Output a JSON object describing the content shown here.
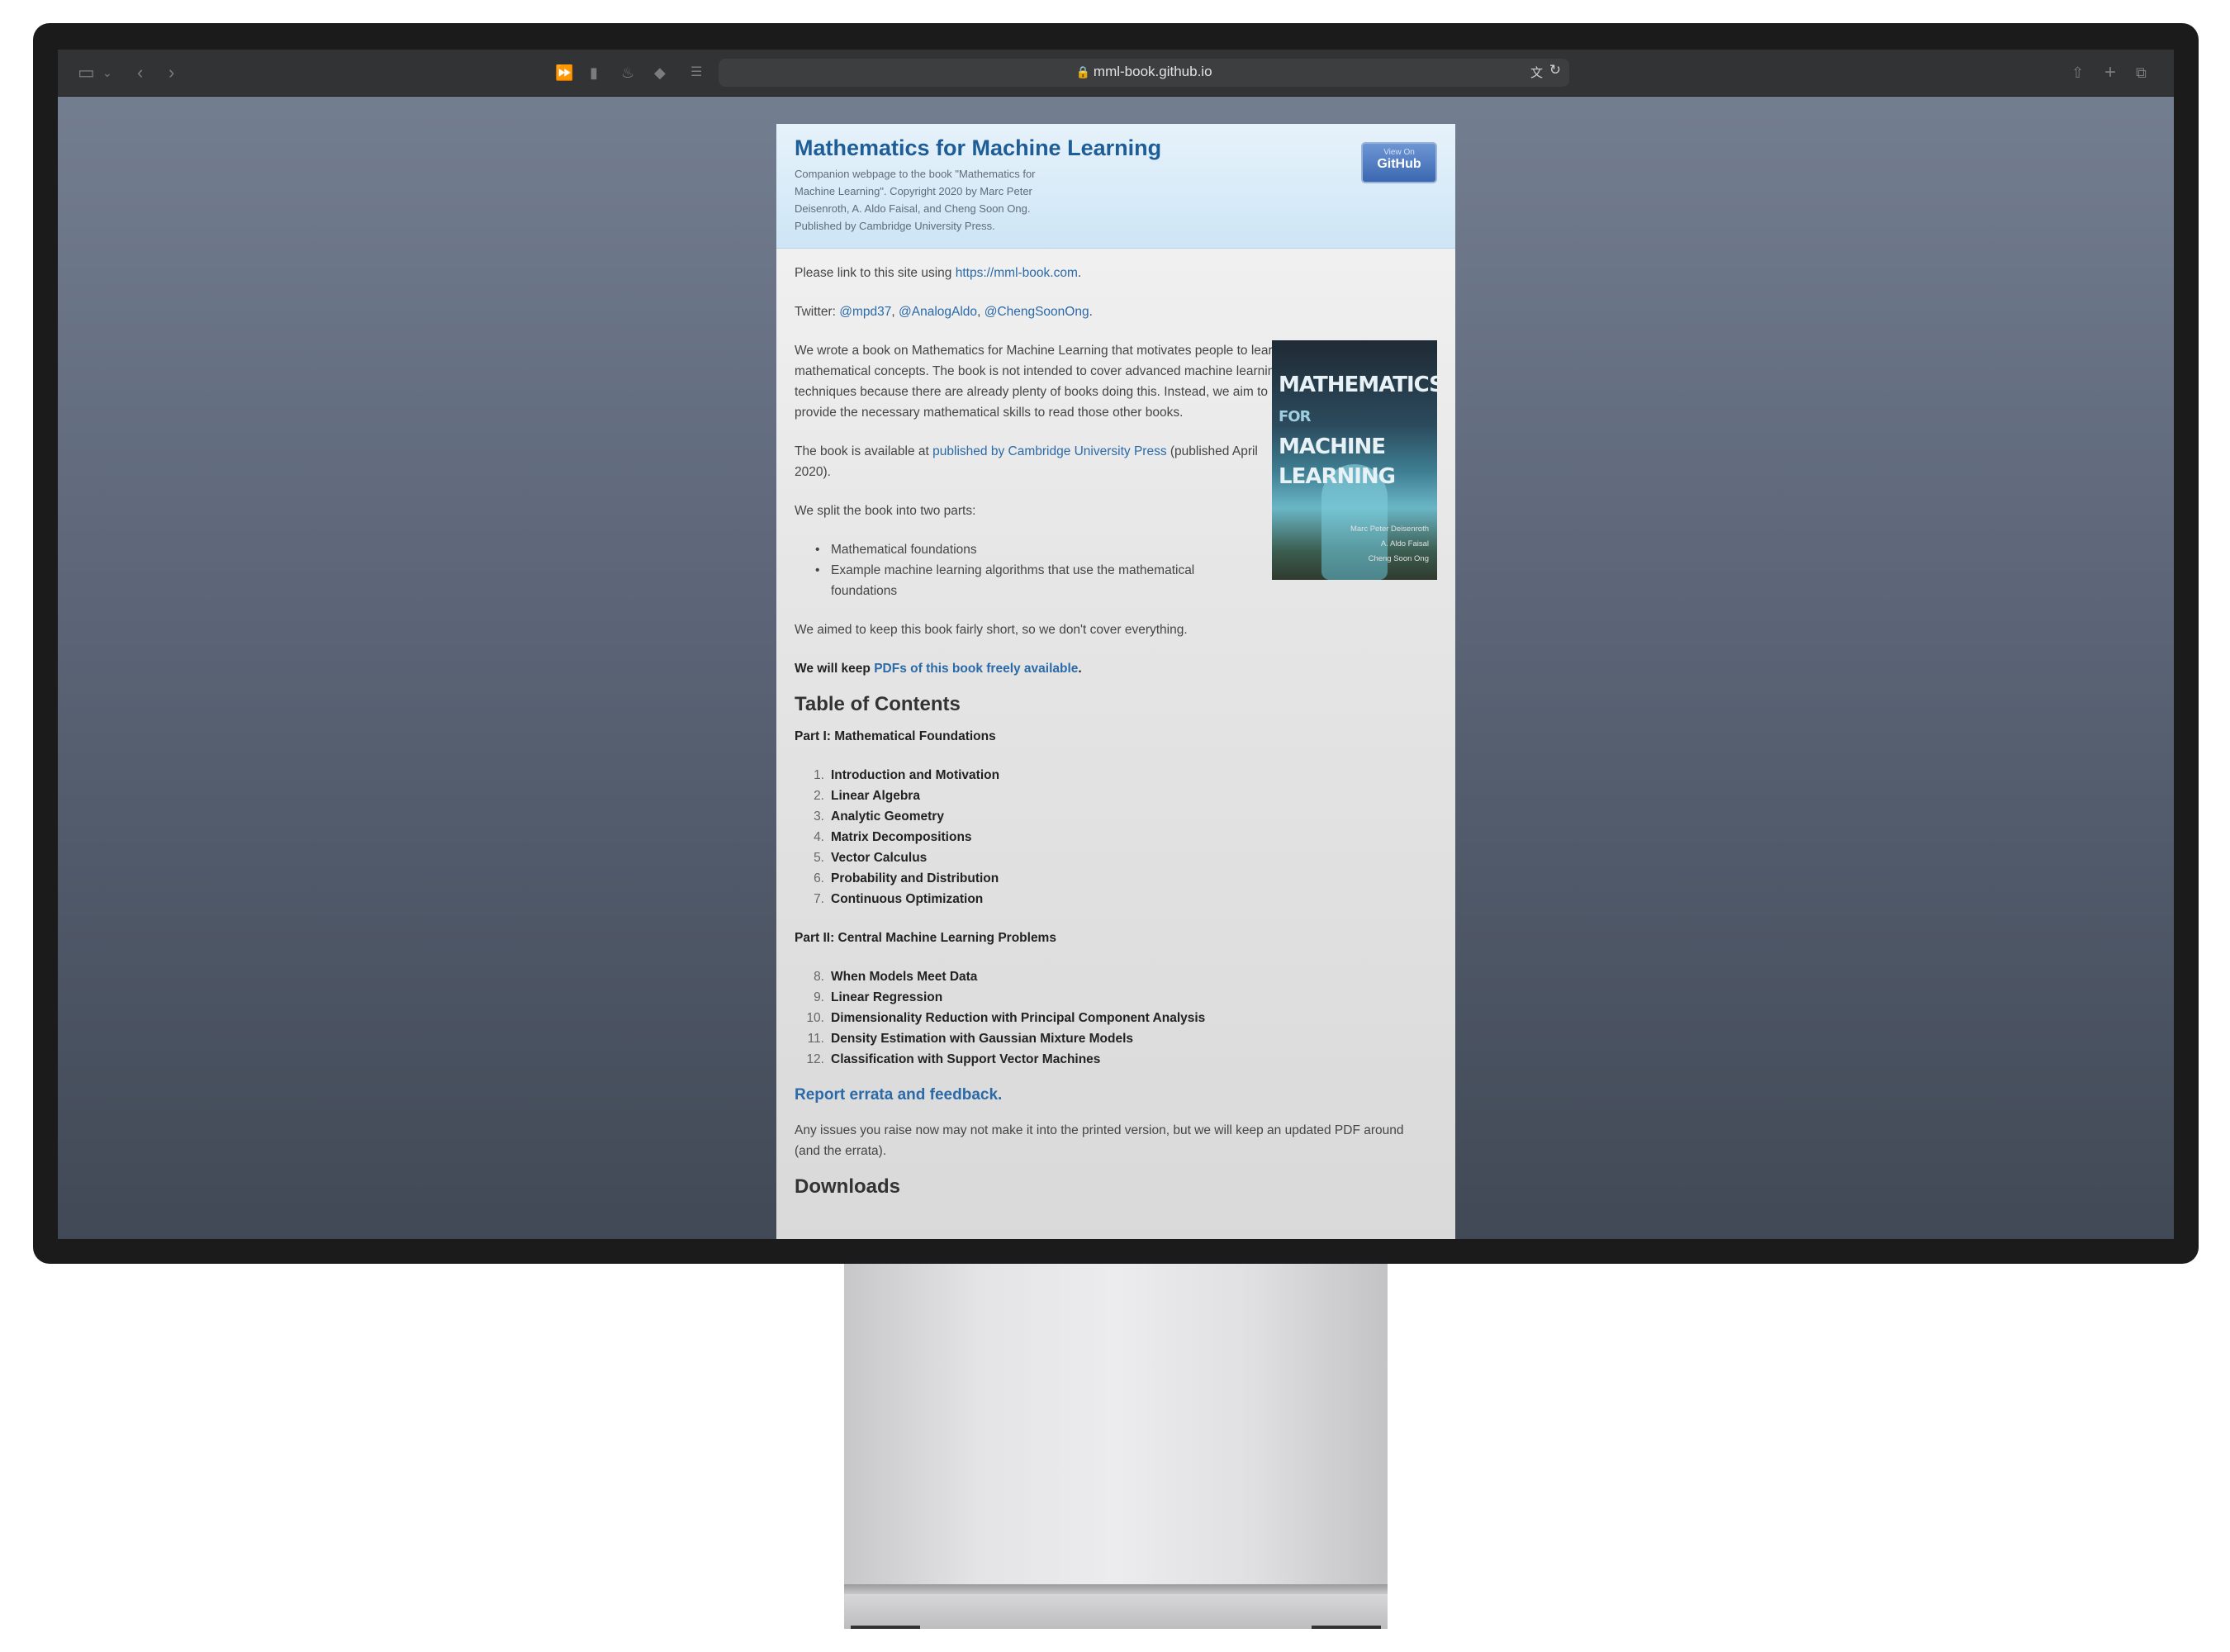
{
  "browser": {
    "url": "mml-book.github.io"
  },
  "site": {
    "title": "Mathematics for Machine Learning",
    "tagline": "Companion webpage to the book \"Mathematics for Machine Learning\". Copyright 2020 by Marc Peter Deisenroth, A. Aldo Faisal, and Cheng Soon Ong. Published by Cambridge University Press.",
    "github_small": "View On",
    "github_big": "GitHub"
  },
  "intro": {
    "link_prefix": "Please link to this site using ",
    "link": "https://mml-book.com",
    "link_suffix": ".",
    "twitter_prefix": "Twitter: ",
    "twitter_1": "@mpd37",
    "twitter_sep1": ", ",
    "twitter_2": "@AnalogAldo",
    "twitter_sep2": ", ",
    "twitter_3": "@ChengSoonOng",
    "twitter_suffix": ".",
    "para1": "We wrote a book on Mathematics for Machine Learning that motivates people to learn mathematical concepts. The book is not intended to cover advanced machine learning techniques because there are already plenty of books doing this. Instead, we aim to provide the necessary mathematical skills to read those other books.",
    "avail_prefix": "The book is available at ",
    "avail_link": "published by Cambridge University Press",
    "avail_suffix": " (published April 2020).",
    "split": "We split the book into two parts:",
    "parts": [
      "Mathematical foundations",
      "Example machine learning algorithms that use the mathematical foundations"
    ],
    "short": "We aimed to keep this book fairly short, so we don't cover everything.",
    "keep_prefix": "We will keep ",
    "keep_link": "PDFs of this book freely available",
    "keep_suffix": "."
  },
  "cover": {
    "title_1": "MATHEMATICS",
    "title_for": "FOR",
    "title_2": "MACHINE LEARNING",
    "author_1": "Marc Peter Deisenroth",
    "author_2": "A. Aldo Faisal",
    "author_3": "Cheng Soon Ong"
  },
  "toc": {
    "heading": "Table of Contents",
    "part1": "Part I: Mathematical Foundations",
    "part1_items": [
      {
        "num": "1.",
        "label": "Introduction and Motivation"
      },
      {
        "num": "2.",
        "label": "Linear Algebra"
      },
      {
        "num": "3.",
        "label": "Analytic Geometry"
      },
      {
        "num": "4.",
        "label": "Matrix Decompositions"
      },
      {
        "num": "5.",
        "label": "Vector Calculus"
      },
      {
        "num": "6.",
        "label": "Probability and Distribution"
      },
      {
        "num": "7.",
        "label": "Continuous Optimization"
      }
    ],
    "part2": "Part II: Central Machine Learning Problems",
    "part2_items": [
      {
        "num": "8.",
        "label": "When Models Meet Data"
      },
      {
        "num": "9.",
        "label": "Linear Regression"
      },
      {
        "num": "10.",
        "label": "Dimensionality Reduction with Principal Component Analysis"
      },
      {
        "num": "11.",
        "label": "Density Estimation with Gaussian Mixture Models"
      },
      {
        "num": "12.",
        "label": "Classification with Support Vector Machines"
      }
    ]
  },
  "errata": {
    "link": "Report errata and feedback",
    "suffix": ".",
    "note": "Any issues you raise now may not make it into the printed version, but we will keep an updated PDF around (and the errata)."
  },
  "downloads": {
    "heading": "Downloads"
  }
}
